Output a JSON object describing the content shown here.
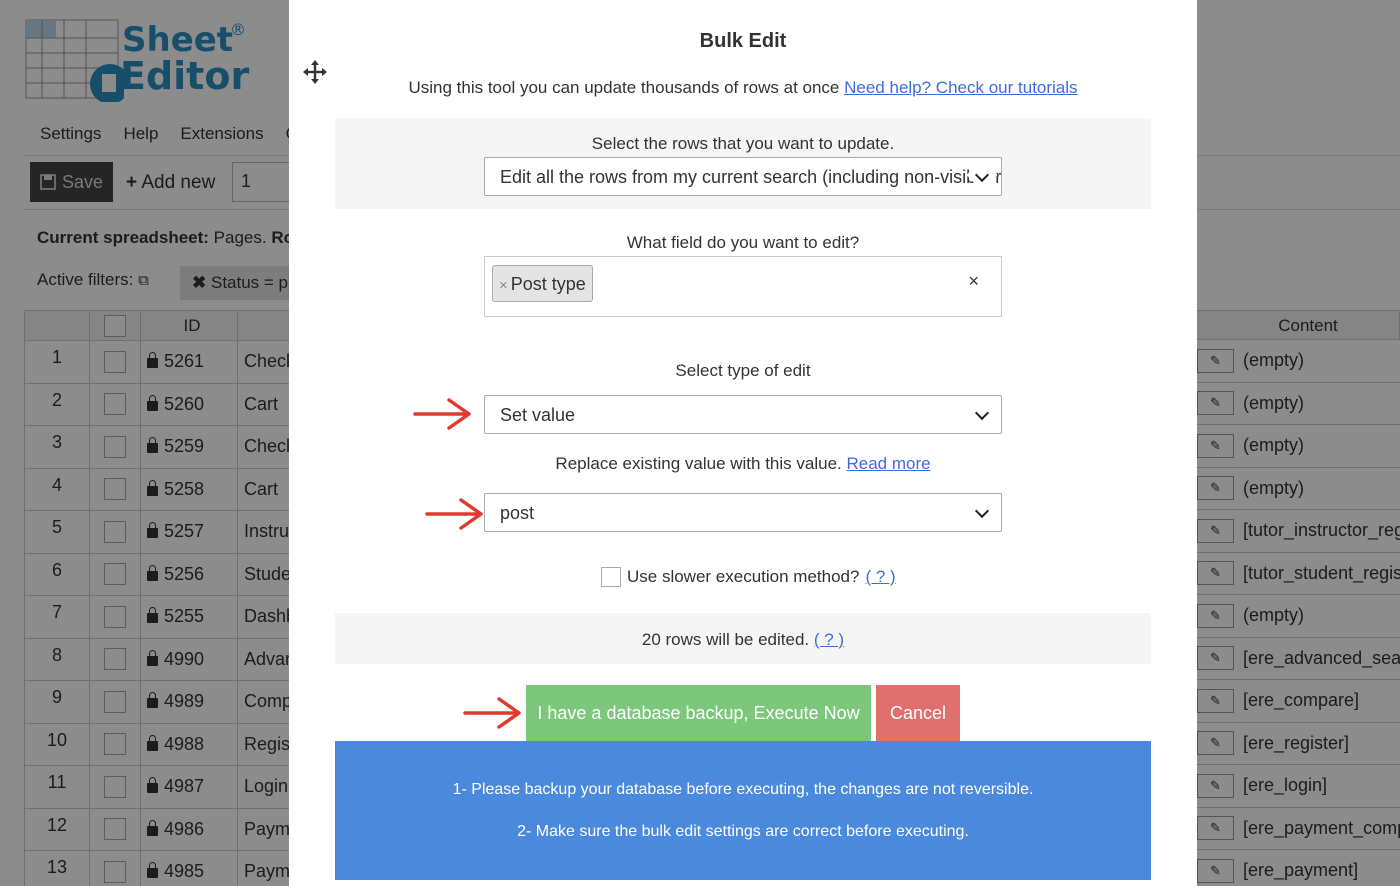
{
  "app": {
    "logo_line1": "Sheet",
    "logo_line2": "Editor",
    "logo_reg": "®",
    "menu": [
      "Settings",
      "Help",
      "Extensions",
      "Gl"
    ],
    "toolbar": {
      "save_label": "Save",
      "add_new_label": "Add new",
      "add_new_count": "1"
    },
    "current_spreadsheet_label": "Current spreadsheet:",
    "current_spreadsheet_value": "Pages.",
    "current_spreadsheet_extra": "Ro",
    "active_filters_label": "Active filters:",
    "filter_chip": "Status = p",
    "columns": {
      "id": "ID",
      "content": "Content"
    },
    "rows": [
      {
        "n": "1",
        "id": "5261",
        "title": "Check",
        "content": "(empty)"
      },
      {
        "n": "2",
        "id": "5260",
        "title": "Cart",
        "content": "(empty)"
      },
      {
        "n": "3",
        "id": "5259",
        "title": "Check",
        "content": "(empty)"
      },
      {
        "n": "4",
        "id": "5258",
        "title": "Cart",
        "content": "(empty)"
      },
      {
        "n": "5",
        "id": "5257",
        "title": "Instru",
        "content": "[tutor_instructor_reg"
      },
      {
        "n": "6",
        "id": "5256",
        "title": "Stude",
        "content": "[tutor_student_regis"
      },
      {
        "n": "7",
        "id": "5255",
        "title": "Dashb",
        "content": "(empty)"
      },
      {
        "n": "8",
        "id": "4990",
        "title": "Advar",
        "content": "[ere_advanced_searc"
      },
      {
        "n": "9",
        "id": "4989",
        "title": "Comp",
        "content": "[ere_compare]"
      },
      {
        "n": "10",
        "id": "4988",
        "title": "Regist",
        "content": "[ere_register]"
      },
      {
        "n": "11",
        "id": "4987",
        "title": "Login",
        "content": "[ere_login]"
      },
      {
        "n": "12",
        "id": "4986",
        "title": "Payme",
        "content": "[ere_payment_comp"
      },
      {
        "n": "13",
        "id": "4985",
        "title": "Payme",
        "content": "[ere_payment]"
      }
    ]
  },
  "modal": {
    "title": "Bulk Edit",
    "intro_text": "Using this tool you can update thousands of rows at once ",
    "intro_link": "Need help? Check our tutorials",
    "rows_label": "Select the rows that you want to update.",
    "rows_select_value": "Edit all the rows from my current search (including non-visible rows).",
    "field_label": "What field do you want to edit?",
    "field_tag": "Post type",
    "field_tag_remove": "×",
    "field_clear": "×",
    "edit_type_label": "Select type of edit",
    "edit_type_value": "Set value",
    "replace_text": "Replace existing value with this value. ",
    "read_more": "Read more",
    "value_select": "post",
    "slower_label": "Use slower execution method?",
    "help_q": "( ? )",
    "rows_edited_text": "20 rows will be edited. ",
    "execute_label": "I have a database backup, Execute Now",
    "cancel_label": "Cancel",
    "warning_1": "1- Please backup your database before executing, the changes are not reversible.",
    "warning_2": "2- Make sure the bulk edit settings are correct before executing."
  },
  "colors": {
    "brand": "#2a8fc2",
    "execute": "#7dc77d",
    "cancel": "#e06f6f",
    "warning_bg": "#4a89dc",
    "link": "#3b6fd8",
    "arrow": "#e03a2f"
  },
  "icons": [
    "move-icon",
    "save-icon",
    "plus-icon",
    "lock-icon",
    "copy-icon",
    "close-icon",
    "chevron-down-icon",
    "edit-icon",
    "arrow-right-icon"
  ]
}
